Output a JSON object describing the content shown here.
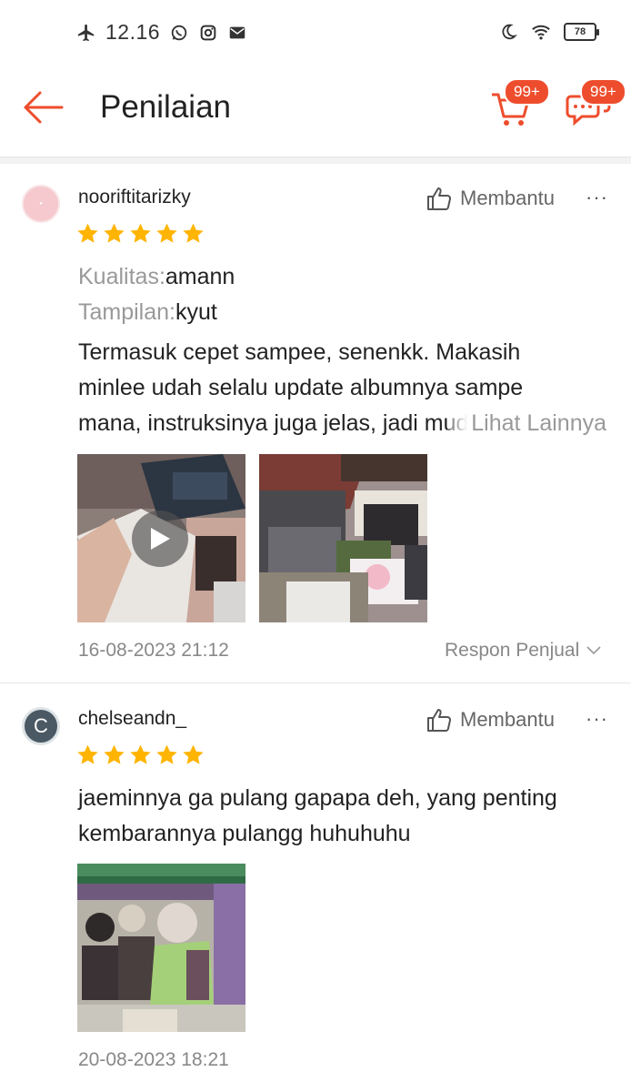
{
  "status_bar": {
    "time": "12.16",
    "battery": "78"
  },
  "header": {
    "title": "Penilaian",
    "cart_badge": "99+",
    "chat_badge": "99+"
  },
  "reviews": [
    {
      "username": "nooriftitarizky",
      "rating": 5,
      "helpful_label": "Membantu",
      "more_label": "···",
      "attributes": [
        {
          "key": "Kualitas:",
          "value": "amann"
        },
        {
          "key": "Tampilan:",
          "value": "kyut"
        }
      ],
      "text_lines": [
        "Termasuk cepet sampee, senenkk. Makasih",
        "minlee udah selalu update albumnya sampe",
        "mana, instruksinya juga jelas, jadi mudah"
      ],
      "see_more": "Lihat Lainnya",
      "date": "16-08-2023 21:12",
      "seller_response": "Respon Penjual"
    },
    {
      "username": "chelseandn_",
      "avatar_letter": "C",
      "rating": 5,
      "helpful_label": "Membantu",
      "more_label": "···",
      "text_lines": [
        "jaeminnya ga pulang gapapa deh, yang penting",
        "kembarannya pulangg huhuhuhu"
      ],
      "date": "20-08-2023 18:21"
    }
  ],
  "colors": {
    "accent": "#ee4d2d",
    "star": "#ffb400",
    "muted": "#999999"
  }
}
